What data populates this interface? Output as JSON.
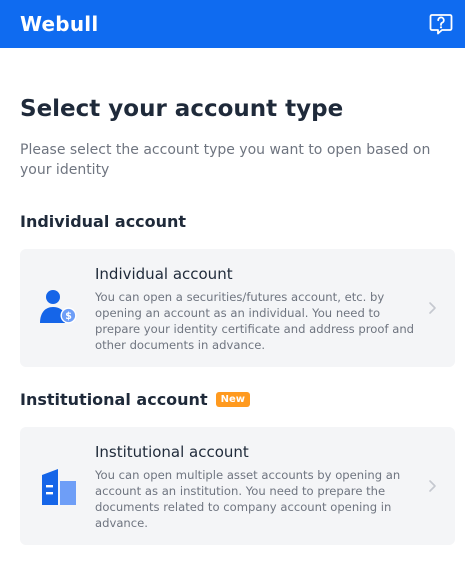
{
  "header": {
    "brand": "Webull",
    "help_icon": "help-question-icon",
    "bg_color": "#0f6bf0"
  },
  "page": {
    "title": "Select your account type",
    "subtitle": "Please select the account type you want to open based on your identity"
  },
  "sections": [
    {
      "heading": "Individual account",
      "badge": "",
      "card": {
        "title": "Individual account",
        "description": "You can open a securities/futures account, etc. by opening an account as an individual. You need to prepare your identity certificate and address proof and other documents in advance.",
        "icon": "person-dollar-icon"
      }
    },
    {
      "heading": "Institutional account",
      "badge": "New",
      "card": {
        "title": "Institutional account",
        "description": "You can open multiple asset accounts by opening an account as an institution. You need to prepare the documents related to company account opening in advance.",
        "icon": "building-icon"
      }
    }
  ],
  "colors": {
    "accent": "#0f6bf0",
    "badge": "#ff9a1f",
    "card_bg": "#f4f5f7"
  }
}
